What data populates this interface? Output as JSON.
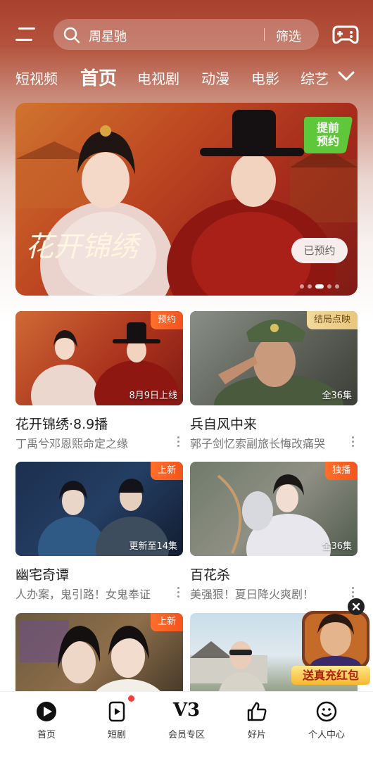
{
  "search": {
    "text": "周星驰",
    "filter_label": "筛选"
  },
  "tabs": [
    "短视频",
    "首页",
    "电视剧",
    "动漫",
    "电影",
    "综艺"
  ],
  "banner": {
    "title": "花开锦绣",
    "badge_line1": "提前",
    "badge_line2": "预约",
    "button_label": "已预约"
  },
  "cards": [
    {
      "tag": "预约",
      "caption": "8月9日上线",
      "title": "花开锦绣·8.9播",
      "subtitle": "丁禹兮邓恩熙命定之缘"
    },
    {
      "tag": "结局点映",
      "caption": "全36集",
      "title": "兵自风中来",
      "subtitle": "郭子剑忆索副旅长悔改痛哭"
    },
    {
      "tag": "上新",
      "caption": "更新至14集",
      "title": "幽宅奇谭",
      "subtitle": "人办案，鬼引路！女鬼奉证"
    },
    {
      "tag": "独播",
      "caption": "全36集",
      "title": "百花杀",
      "subtitle": "美强狠！夏日降火爽剧！"
    },
    {
      "tag": "上新"
    }
  ],
  "ad": {
    "label": "送真充红包"
  },
  "bottom_nav": [
    {
      "label": "首页"
    },
    {
      "label": "短剧"
    },
    {
      "label": "会员专区",
      "icon_text": "V3"
    },
    {
      "label": "好片"
    },
    {
      "label": "个人中心"
    }
  ],
  "colors": {
    "accent": "#f2541d",
    "header": "#a8412e",
    "badge_green": "#5fc83a"
  }
}
